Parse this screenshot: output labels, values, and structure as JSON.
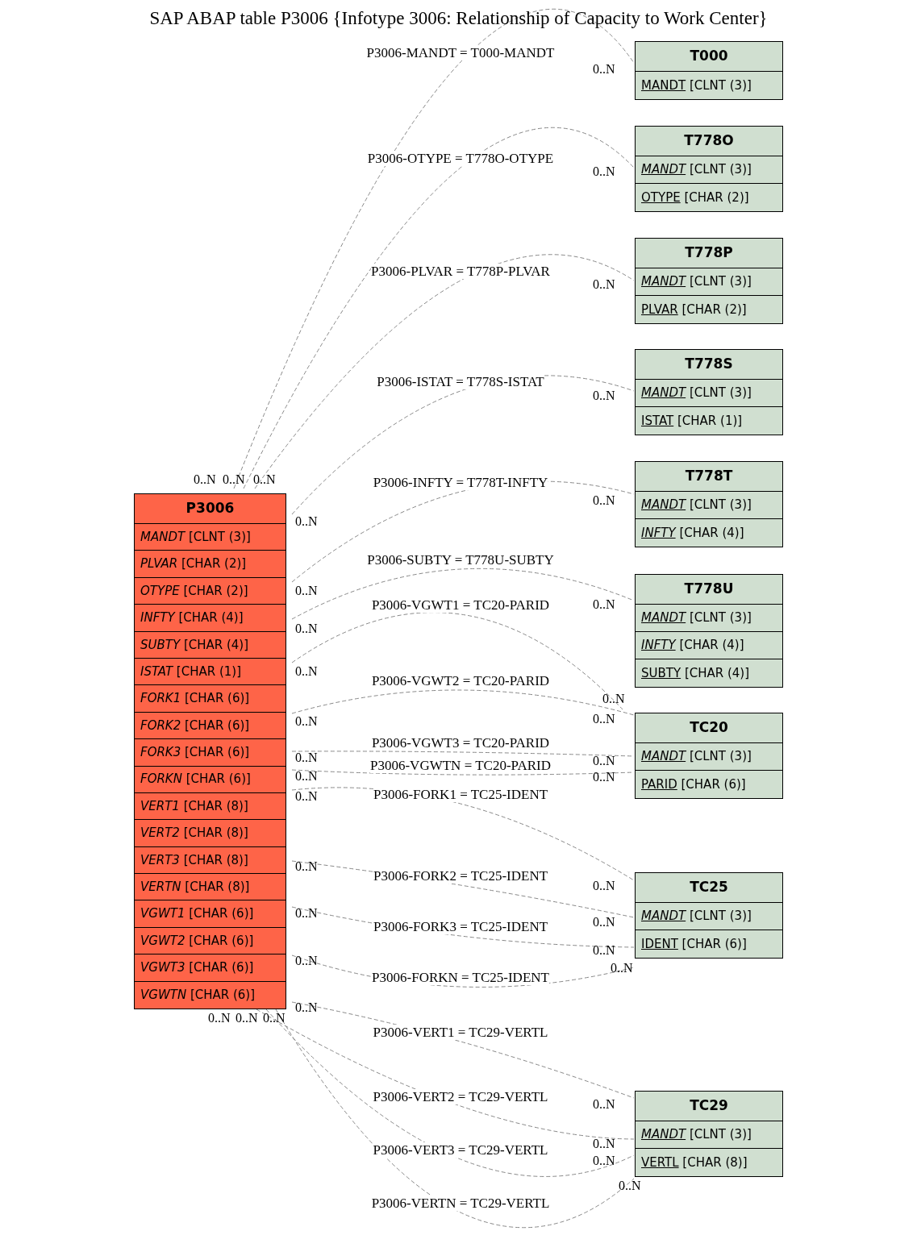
{
  "title": "SAP ABAP table P3006 {Infotype 3006: Relationship of Capacity to Work Center}",
  "tables": [
    {
      "kind": "main",
      "name": "P3006",
      "fields": [
        {
          "name": "MANDT",
          "type": "[CLNT (3)]",
          "italic": true,
          "underlined": false
        },
        {
          "name": "PLVAR",
          "type": "[CHAR (2)]",
          "italic": true,
          "underlined": false
        },
        {
          "name": "OTYPE",
          "type": "[CHAR (2)]",
          "italic": true,
          "underlined": false
        },
        {
          "name": "INFTY",
          "type": "[CHAR (4)]",
          "italic": true,
          "underlined": false
        },
        {
          "name": "SUBTY",
          "type": "[CHAR (4)]",
          "italic": true,
          "underlined": false
        },
        {
          "name": "ISTAT",
          "type": "[CHAR (1)]",
          "italic": true,
          "underlined": false
        },
        {
          "name": "FORK1",
          "type": "[CHAR (6)]",
          "italic": true,
          "underlined": false
        },
        {
          "name": "FORK2",
          "type": "[CHAR (6)]",
          "italic": true,
          "underlined": false
        },
        {
          "name": "FORK3",
          "type": "[CHAR (6)]",
          "italic": true,
          "underlined": false
        },
        {
          "name": "FORKN",
          "type": "[CHAR (6)]",
          "italic": true,
          "underlined": false
        },
        {
          "name": "VERT1",
          "type": "[CHAR (8)]",
          "italic": true,
          "underlined": false
        },
        {
          "name": "VERT2",
          "type": "[CHAR (8)]",
          "italic": true,
          "underlined": false
        },
        {
          "name": "VERT3",
          "type": "[CHAR (8)]",
          "italic": true,
          "underlined": false
        },
        {
          "name": "VERTN",
          "type": "[CHAR (8)]",
          "italic": true,
          "underlined": false
        },
        {
          "name": "VGWT1",
          "type": "[CHAR (6)]",
          "italic": true,
          "underlined": false
        },
        {
          "name": "VGWT2",
          "type": "[CHAR (6)]",
          "italic": true,
          "underlined": false
        },
        {
          "name": "VGWT3",
          "type": "[CHAR (6)]",
          "italic": true,
          "underlined": false
        },
        {
          "name": "VGWTN",
          "type": "[CHAR (6)]",
          "italic": true,
          "underlined": false
        }
      ]
    },
    {
      "kind": "related",
      "name": "T000",
      "fields": [
        {
          "name": "MANDT",
          "type": "[CLNT (3)]",
          "italic": false,
          "underlined": true
        }
      ]
    },
    {
      "kind": "related",
      "name": "T778O",
      "fields": [
        {
          "name": "MANDT",
          "type": "[CLNT (3)]",
          "italic": true,
          "underlined": true
        },
        {
          "name": "OTYPE",
          "type": "[CHAR (2)]",
          "italic": false,
          "underlined": true
        }
      ]
    },
    {
      "kind": "related",
      "name": "T778P",
      "fields": [
        {
          "name": "MANDT",
          "type": "[CLNT (3)]",
          "italic": true,
          "underlined": true
        },
        {
          "name": "PLVAR",
          "type": "[CHAR (2)]",
          "italic": false,
          "underlined": true
        }
      ]
    },
    {
      "kind": "related",
      "name": "T778S",
      "fields": [
        {
          "name": "MANDT",
          "type": "[CLNT (3)]",
          "italic": true,
          "underlined": true
        },
        {
          "name": "ISTAT",
          "type": "[CHAR (1)]",
          "italic": false,
          "underlined": true
        }
      ]
    },
    {
      "kind": "related",
      "name": "T778T",
      "fields": [
        {
          "name": "MANDT",
          "type": "[CLNT (3)]",
          "italic": true,
          "underlined": true
        },
        {
          "name": "INFTY",
          "type": "[CHAR (4)]",
          "italic": true,
          "underlined": true
        }
      ]
    },
    {
      "kind": "related",
      "name": "T778U",
      "fields": [
        {
          "name": "MANDT",
          "type": "[CLNT (3)]",
          "italic": true,
          "underlined": true
        },
        {
          "name": "INFTY",
          "type": "[CHAR (4)]",
          "italic": true,
          "underlined": true
        },
        {
          "name": "SUBTY",
          "type": "[CHAR (4)]",
          "italic": false,
          "underlined": true
        }
      ]
    },
    {
      "kind": "related",
      "name": "TC20",
      "fields": [
        {
          "name": "MANDT",
          "type": "[CLNT (3)]",
          "italic": true,
          "underlined": true
        },
        {
          "name": "PARID",
          "type": "[CHAR (6)]",
          "italic": false,
          "underlined": true
        }
      ]
    },
    {
      "kind": "related",
      "name": "TC25",
      "fields": [
        {
          "name": "MANDT",
          "type": "[CLNT (3)]",
          "italic": true,
          "underlined": true
        },
        {
          "name": "IDENT",
          "type": "[CHAR (6)]",
          "italic": false,
          "underlined": true
        }
      ]
    },
    {
      "kind": "related",
      "name": "TC29",
      "fields": [
        {
          "name": "MANDT",
          "type": "[CLNT (3)]",
          "italic": true,
          "underlined": true
        },
        {
          "name": "VERTL",
          "type": "[CHAR (8)]",
          "italic": false,
          "underlined": true
        }
      ]
    }
  ],
  "relations": [
    {
      "label": "P3006-MANDT = T000-MANDT",
      "source_cardinality": "0..N",
      "target_cardinality": "0..N"
    },
    {
      "label": "P3006-OTYPE = T778O-OTYPE",
      "source_cardinality": "0..N",
      "target_cardinality": "0..N"
    },
    {
      "label": "P3006-PLVAR = T778P-PLVAR",
      "source_cardinality": "0..N",
      "target_cardinality": "0..N"
    },
    {
      "label": "P3006-ISTAT = T778S-ISTAT",
      "source_cardinality": "0..N",
      "target_cardinality": "0..N"
    },
    {
      "label": "P3006-INFTY = T778T-INFTY",
      "source_cardinality": "0..N",
      "target_cardinality": "0..N"
    },
    {
      "label": "P3006-SUBTY = T778U-SUBTY",
      "source_cardinality": "0..N",
      "target_cardinality": "0..N"
    },
    {
      "label": "P3006-VGWT1 = TC20-PARID",
      "source_cardinality": "0..N",
      "target_cardinality": "0..N"
    },
    {
      "label": "P3006-VGWT2 = TC20-PARID",
      "source_cardinality": "0..N",
      "target_cardinality": "0..N"
    },
    {
      "label": "P3006-VGWT3 = TC20-PARID",
      "source_cardinality": "0..N",
      "target_cardinality": "0..N"
    },
    {
      "label": "P3006-VGWTN = TC20-PARID",
      "source_cardinality": "0..N",
      "target_cardinality": "0..N"
    },
    {
      "label": "P3006-FORK1 = TC25-IDENT",
      "source_cardinality": "0..N",
      "target_cardinality": "0..N"
    },
    {
      "label": "P3006-FORK2 = TC25-IDENT",
      "source_cardinality": "0..N",
      "target_cardinality": "0..N"
    },
    {
      "label": "P3006-FORK3 = TC25-IDENT",
      "source_cardinality": "0..N",
      "target_cardinality": "0..N"
    },
    {
      "label": "P3006-FORKN = TC25-IDENT",
      "source_cardinality": "0..N",
      "target_cardinality": "0..N"
    },
    {
      "label": "P3006-VERT1 = TC29-VERTL",
      "source_cardinality": "0..N",
      "target_cardinality": "0..N"
    },
    {
      "label": "P3006-VERT2 = TC29-VERTL",
      "source_cardinality": "0..N",
      "target_cardinality": "0..N"
    },
    {
      "label": "P3006-VERT3 = TC29-VERTL",
      "source_cardinality": "0..N",
      "target_cardinality": "0..N"
    },
    {
      "label": "P3006-VERTN = TC29-VERTL",
      "source_cardinality": "0..N",
      "target_cardinality": "0..N"
    }
  ]
}
